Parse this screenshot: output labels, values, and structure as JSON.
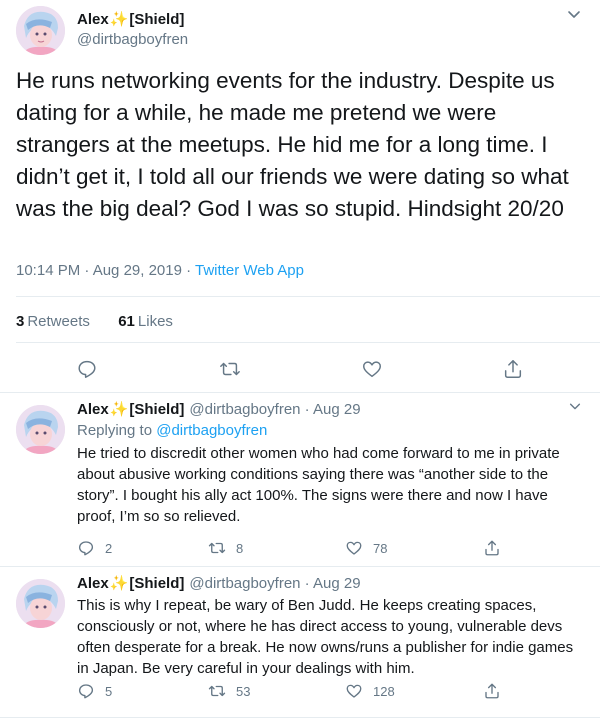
{
  "main_tweet": {
    "author_name": "Alex",
    "author_tag": "[Shield]",
    "handle": "@dirtbagboyfren",
    "text": "He runs networking events for the industry. Despite us dating for a while, he made me pretend we were strangers at the meetups. He hid me for a long time. I didn’t get it, I told all our friends we were dating so what was the big deal? God I was so stupid. Hindsight 20/20",
    "time": "10:14 PM · Aug 29, 2019 · ",
    "app": "Twitter Web App",
    "retweets_count": "3",
    "retweets_label": "Retweets",
    "likes_count": "61",
    "likes_label": "Likes"
  },
  "replies": [
    {
      "author_name": "Alex",
      "author_tag": "[Shield]",
      "handle": "@dirtbagboyfren · Aug 29",
      "replying_prefix": "Replying to ",
      "replying_handle": "@dirtbagboyfren",
      "text": "He tried to discredit other women who had come forward to me in private about abusive working conditions saying there was “another side to the story”. I bought his ally act 100%. The signs were there and now I have proof, I’m so so relieved.",
      "reply_count": "2",
      "retweet_count": "8",
      "like_count": "78"
    },
    {
      "author_name": "Alex",
      "author_tag": "[Shield]",
      "handle": "@dirtbagboyfren · Aug 29",
      "text": "This is why I repeat, be wary of Ben Judd. He keeps creating spaces, consciously or not, where he has direct access to young, vulnerable devs often desperate for a break. He now owns/runs a publisher for indie games in Japan. Be very careful in your dealings with him.",
      "reply_count": "5",
      "retweet_count": "53",
      "like_count": "128"
    }
  ],
  "colors": {
    "accent": "#1da1f2",
    "muted": "#657786",
    "text": "#14171a",
    "border": "#e6ecf0",
    "sparkle": "#f4b400"
  },
  "icons": [
    "reply-icon",
    "retweet-icon",
    "like-icon",
    "share-icon",
    "chevron-down-icon",
    "sparkle-icon"
  ]
}
